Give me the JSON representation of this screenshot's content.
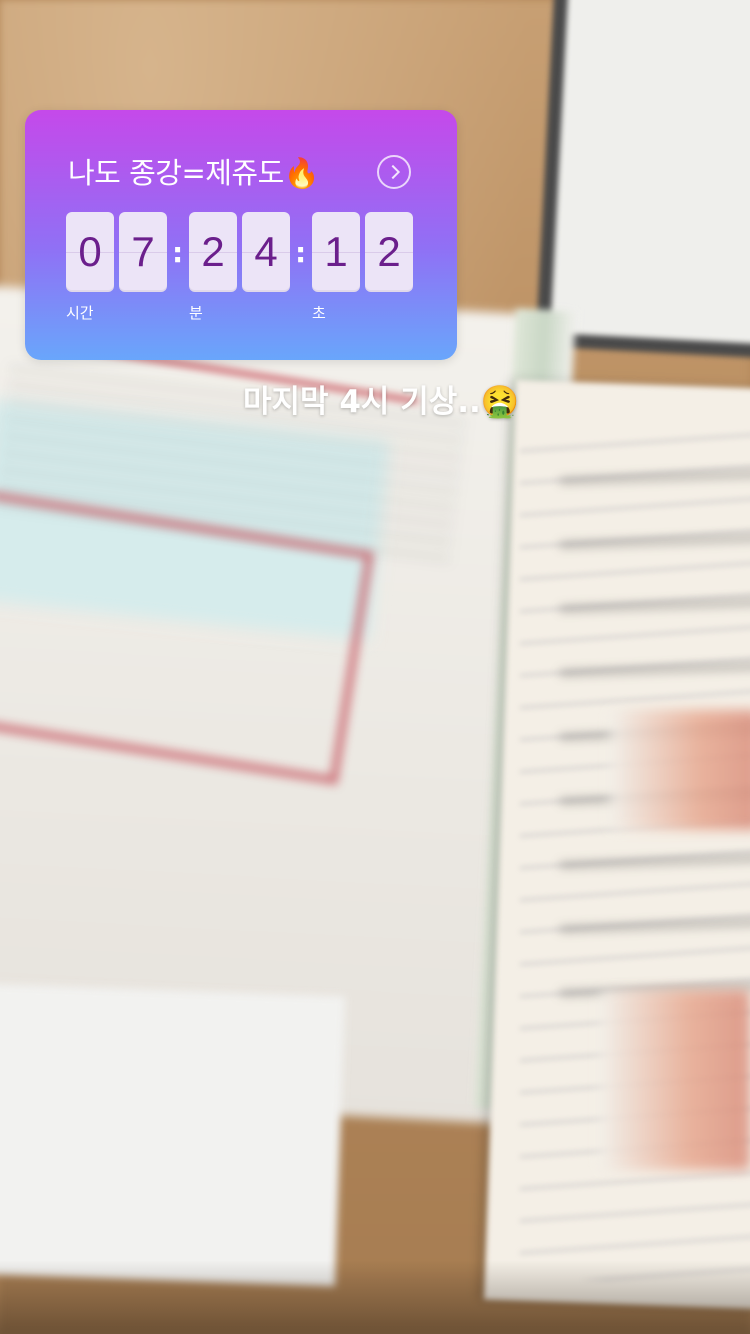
{
  "countdown": {
    "title": "나도 종강=제쥬도🔥",
    "digits": [
      "0",
      "7",
      "2",
      "4",
      "1",
      "2"
    ],
    "separator": ":",
    "unit_labels": [
      "시간",
      "분",
      "초"
    ]
  },
  "caption": "마지막 4시 기상..🤮",
  "icons": {
    "chevron": "chevron-right-circle-icon"
  },
  "colors": {
    "gradient_top": "#c549ea",
    "gradient_bottom": "#69a6fb",
    "digit_bg": "#ece4f7",
    "digit_text": "#6b1f8c"
  }
}
